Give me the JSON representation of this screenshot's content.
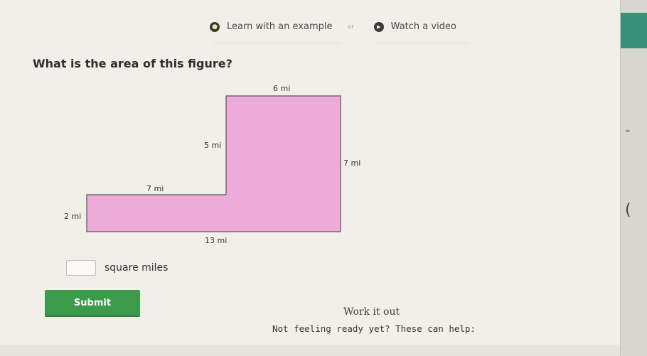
{
  "help_bar": {
    "learn_label": "Learn with an example",
    "or_label": "or",
    "watch_label": "Watch a video"
  },
  "question": "What is the area of this figure?",
  "figure": {
    "fill_color": "#eeaad8",
    "stroke_color": "#555555",
    "labels": {
      "top": "6 mi",
      "upper_left": "5 mi",
      "right": "7 mi",
      "step": "7 mi",
      "left": "2 mi",
      "bottom": "13 mi"
    }
  },
  "answer": {
    "value": "",
    "unit": "square miles"
  },
  "submit_label": "Submit",
  "work_it_out": "Work it out",
  "help_prompt": "Not feeling ready yet? These can help:",
  "colors": {
    "submit": "#3a9b4a",
    "side_accent": "#3a8f7a"
  }
}
